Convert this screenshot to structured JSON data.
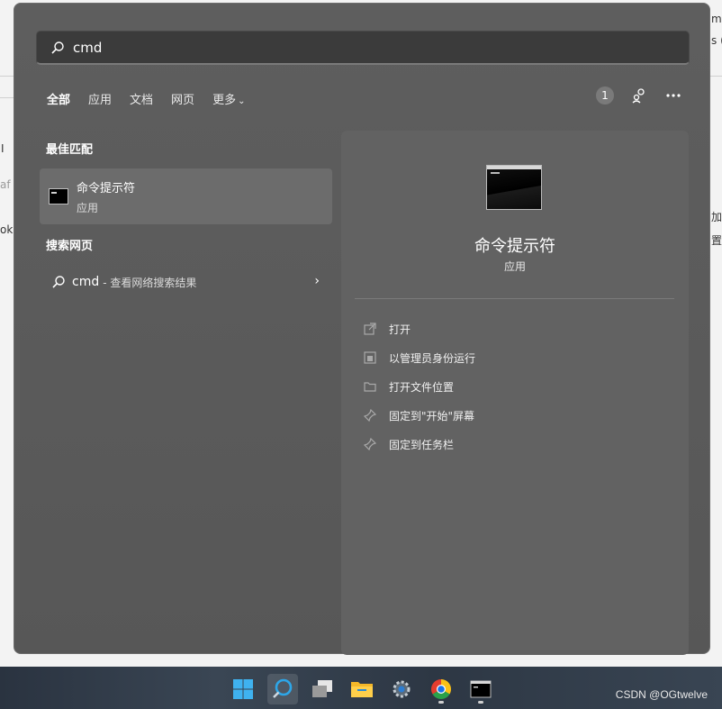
{
  "search": {
    "value": "cmd"
  },
  "tabs": [
    {
      "label": "全部",
      "active": true
    },
    {
      "label": "应用"
    },
    {
      "label": "文档"
    },
    {
      "label": "网页"
    },
    {
      "label": "更多"
    }
  ],
  "header_right": {
    "badge_count": "1"
  },
  "best_match": {
    "title": "最佳匹配",
    "app_name": "命令提示符",
    "app_type": "应用"
  },
  "web_search": {
    "title": "搜索网页",
    "query": "cmd",
    "description": "- 查看网络搜索结果"
  },
  "detail": {
    "app_name": "命令提示符",
    "app_type": "应用",
    "actions": [
      {
        "label": "打开",
        "icon": "open-icon"
      },
      {
        "label": "以管理员身份运行",
        "icon": "shield-icon"
      },
      {
        "label": "打开文件位置",
        "icon": "folder-icon"
      },
      {
        "label": "固定到\"开始\"屏幕",
        "icon": "pin-icon"
      },
      {
        "label": "固定到任务栏",
        "icon": "pin-icon"
      }
    ]
  },
  "background": {
    "fragments": [
      "mb",
      "s (c",
      "I",
      "af",
      "ok",
      "加",
      "置."
    ]
  },
  "taskbar": {
    "watermark": "CSDN @OGtwelve"
  },
  "colors": {
    "panel": "#5b5b5b",
    "detail": "#626262",
    "search_box": "#3b3b3b"
  }
}
